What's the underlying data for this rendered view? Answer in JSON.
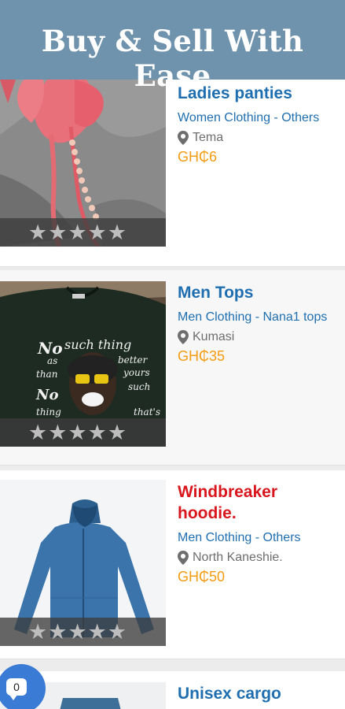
{
  "header": {
    "title": "Buy & Sell With Ease"
  },
  "listings": [
    {
      "title": "Ladies panties",
      "category": "Women Clothing",
      "subcategory": "Others",
      "location": "Tema",
      "price": "GH₵6",
      "rating": 0,
      "title_color": "#1f6fb0"
    },
    {
      "title": "Men Tops",
      "category": "Men Clothing",
      "subcategory": "Nana1 tops",
      "location": "Kumasi",
      "price": "GH₵35",
      "rating": 0,
      "title_color": "#1f6fb0"
    },
    {
      "title": "Windbreaker hoodie.",
      "category": "Men Clothing",
      "subcategory": "Others",
      "location": "North Kaneshie.",
      "price": "GH₵50",
      "rating": 0,
      "title_color": "#d9161d"
    },
    {
      "title": "Unisex cargo",
      "title_color": "#1f6fb0"
    }
  ],
  "chat": {
    "count": "0"
  },
  "separator": " - ",
  "stars": "★★★★★",
  "colors": {
    "header": "#7093ad",
    "link": "#1f6fb0",
    "price": "#f39c12",
    "highlight": "#d9161d"
  }
}
